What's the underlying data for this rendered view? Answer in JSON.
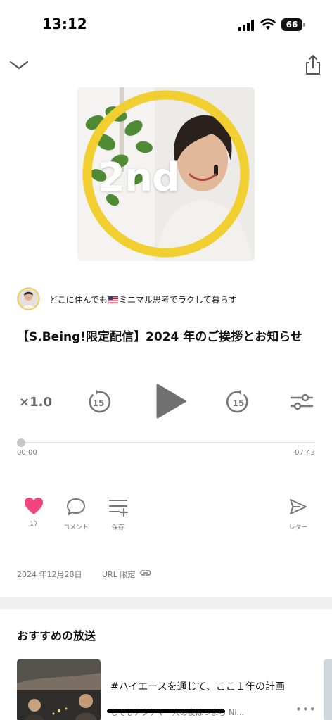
{
  "status_bar": {
    "time": "13:12",
    "battery": "66"
  },
  "nav": {
    "collapse_icon": "chevron-down-icon",
    "share_icon": "share-icon"
  },
  "cover": {
    "label": "2nd",
    "ring_color": "#F2CF30"
  },
  "channel": {
    "name_prefix": "どこに住んでも",
    "name_suffix": "ミニマル思考でラクして暮らす"
  },
  "episode": {
    "title": "【S.Being!限定配信】2024 年のご挨拶とお知らせ"
  },
  "player": {
    "speed": "×1.0",
    "skip_back_seconds": "15",
    "skip_forward_seconds": "15",
    "elapsed": "00:00",
    "remaining": "-07:43",
    "progress": 0
  },
  "actions": {
    "like_count": "17",
    "comment_label": "コメント",
    "save_label": "保存",
    "letter_label": "レター"
  },
  "meta": {
    "date": "2024 年12月28日",
    "visibility": "URL 限定"
  },
  "recommended": {
    "section_title": "おすすめの放送",
    "items": [
      {
        "title": "#ハイエースを通じて、ここ１年の計画",
        "subtitle": "しでもナタケマー人の夜はつまら Ni..."
      }
    ]
  },
  "colors": {
    "accent_like": "#F0467C",
    "text_muted": "#777777"
  }
}
